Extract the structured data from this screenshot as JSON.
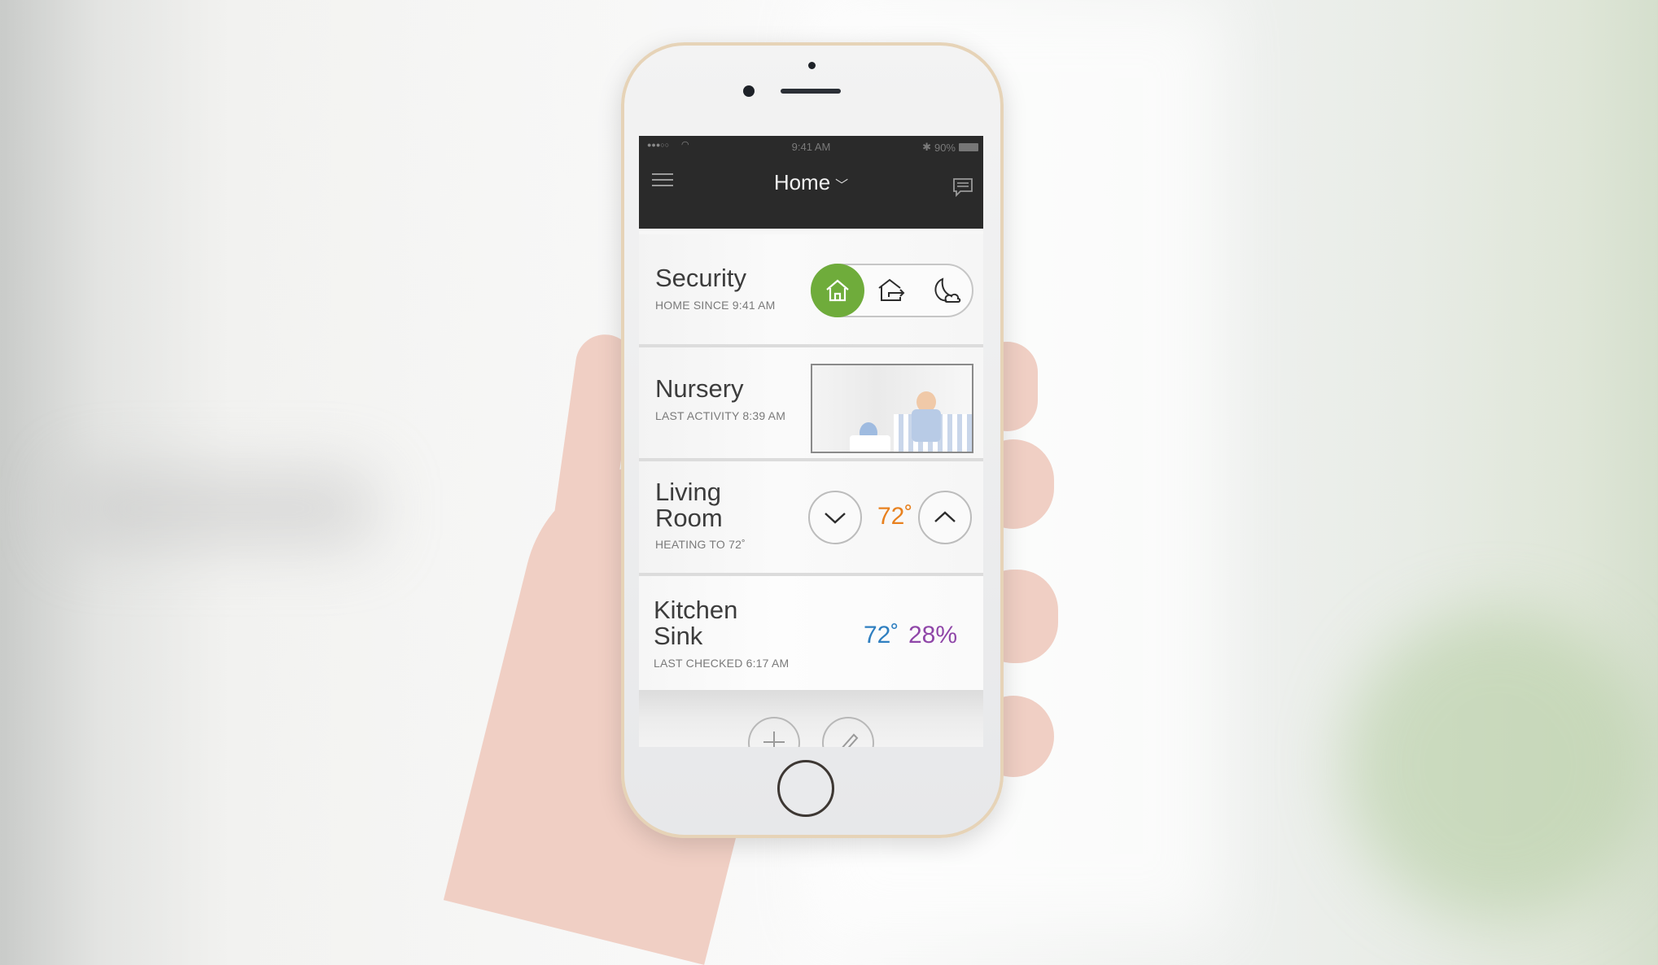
{
  "status_bar": {
    "signal": "●●●○○",
    "time": "9:41 AM",
    "bluetooth": "✱",
    "battery": "90%"
  },
  "nav": {
    "title": "Home",
    "title_dropdown_icon": "chevron-down-icon",
    "left_icon": "menu-icon",
    "right_icon": "chat-icon"
  },
  "cards": {
    "security": {
      "title": "Security",
      "subtitle": "HOME SINCE 9:41 AM",
      "modes": [
        {
          "name": "home",
          "icon": "house-icon",
          "active": true
        },
        {
          "name": "away",
          "icon": "house-exit-icon",
          "active": false
        },
        {
          "name": "night",
          "icon": "moon-cloud-icon",
          "active": false
        }
      ],
      "active_color": "#6fac3b"
    },
    "nursery": {
      "title": "Nursery",
      "subtitle": "LAST ACTIVITY 8:39 AM",
      "thumbnail": "camera-snapshot"
    },
    "living_room": {
      "title_line1": "Living",
      "title_line2": "Room",
      "subtitle": "HEATING TO 72˚",
      "setpoint": "72˚",
      "setpoint_color": "#e8811f"
    },
    "kitchen_sink": {
      "title_line1": "Kitchen",
      "title_line2": "Sink",
      "subtitle": "LAST CHECKED 6:17 AM",
      "temperature": "72˚",
      "temperature_color": "#2f7fc0",
      "humidity": "28%",
      "humidity_color": "#8f46a8"
    }
  },
  "footer": {
    "add_icon": "plus-icon",
    "edit_icon": "pencil-icon"
  }
}
